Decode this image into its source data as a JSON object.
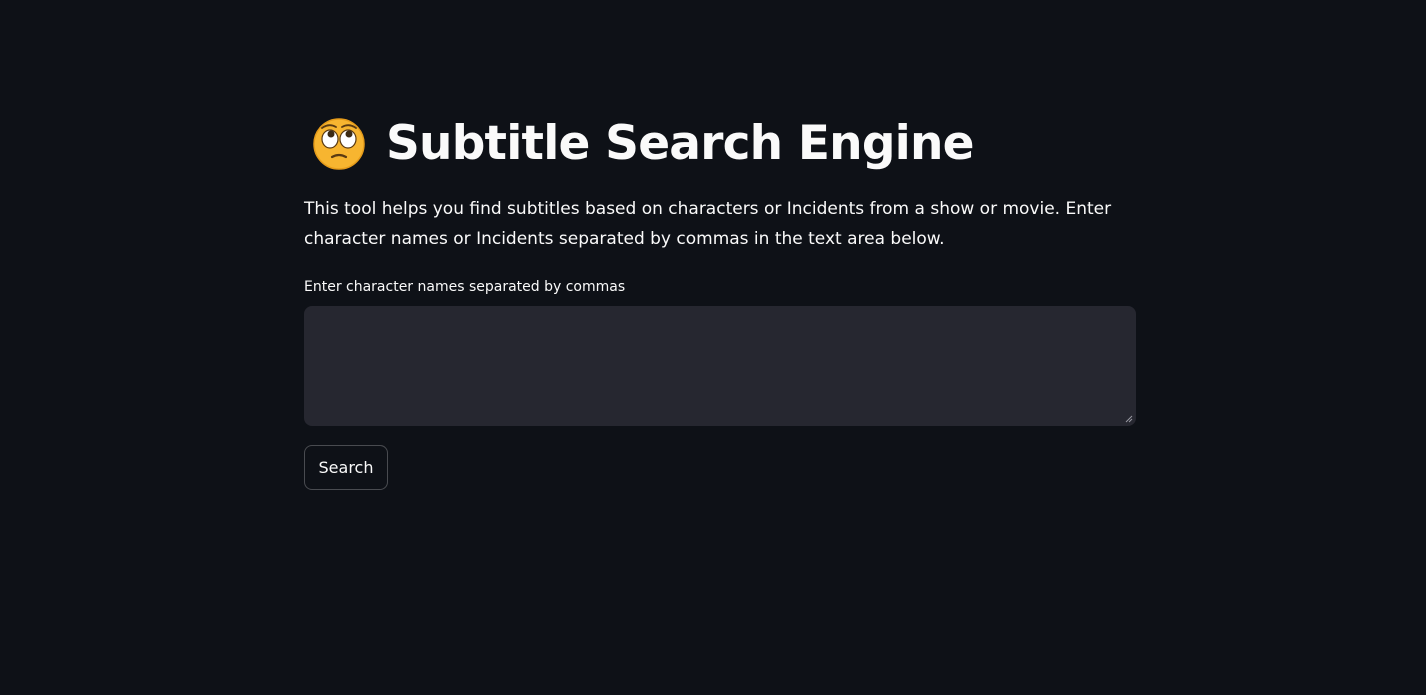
{
  "header": {
    "title": "Subtitle Search Engine",
    "icon": "face-with-rolling-eyes-icon",
    "description": "This tool helps you find subtitles based on characters or Incidents from a show or movie. Enter character names or Incidents separated by commas in the text area below."
  },
  "form": {
    "input_label": "Enter character names separated by commas",
    "input_value": "",
    "search_label": "Search"
  },
  "colors": {
    "background": "#0e1117",
    "text": "#fafafa",
    "input_background": "#262730",
    "emoji_yellow": "#f7b530"
  }
}
